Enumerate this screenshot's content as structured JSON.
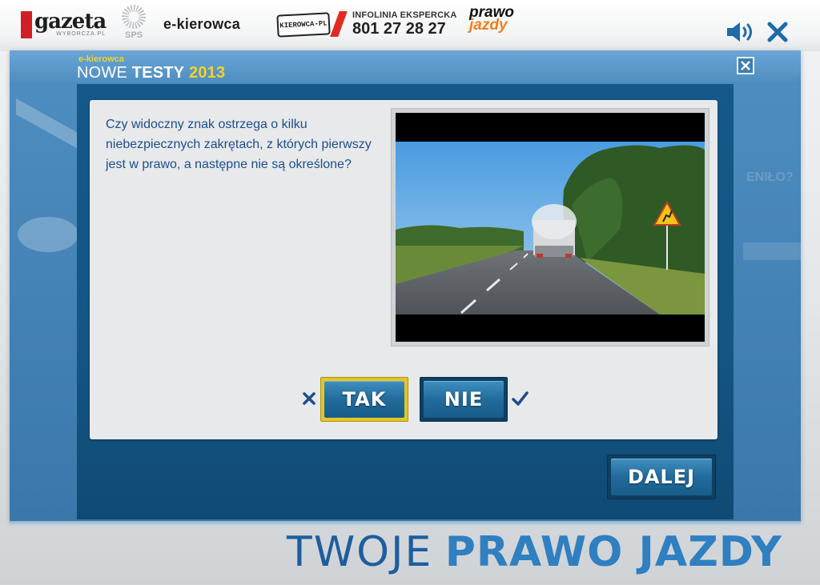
{
  "header": {
    "gazeta_logo": "gazeta",
    "gazeta_sub": "WYBORCZA.PL",
    "sps_logo": "SPS",
    "ekierowca_logo": "e-kierowca",
    "plate_logo": "KIEROWCA-PL",
    "infolinia_label": "INFOLINIA EKSPERCKA",
    "infolinia_number": "801 27 28 27",
    "prawo_logo_top": "prawo",
    "prawo_logo_bottom": "jazdy"
  },
  "app": {
    "brand_small": "e-kierowca",
    "brand_nowe": "NOWE",
    "brand_testy": "TESTY",
    "brand_year": "2013",
    "bg_ghost_text": "ENIŁO?"
  },
  "question": {
    "text": "Czy widoczny znak ostrzega o kilku niebezpiecznych zakrętach, z których pierwszy jest w prawo, a następne nie są określone?"
  },
  "answers": {
    "tak_label": "TAK",
    "nie_label": "NIE",
    "tak_state": "selected-wrong",
    "nie_state": "correct"
  },
  "footer": {
    "next_label": "DALEJ",
    "slogan_light": "TWOJE",
    "slogan_bold": "PRAWO JAZDY"
  },
  "colors": {
    "frame_blue": "#4f8ec0",
    "panel_blue": "#145584",
    "button_blue": "#226b9c",
    "selected_border": "#e6c522",
    "text_blue": "#1d4e8c",
    "brand_yellow": "#f0d330"
  },
  "icons": {
    "sound": "speaker-icon",
    "close_app": "close-icon",
    "close_modal": "close-box-icon",
    "wrong": "cross-mark-icon",
    "correct": "check-mark-icon"
  }
}
